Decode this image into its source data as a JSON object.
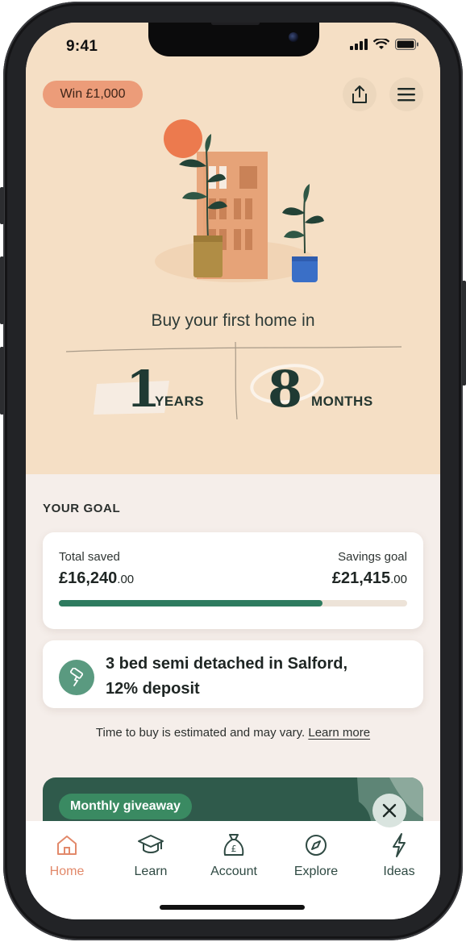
{
  "status": {
    "time": "9:41"
  },
  "header": {
    "promo_label": "Win £1,000",
    "share_icon": "share-icon",
    "menu_icon": "menu-icon"
  },
  "hero": {
    "headline": "Buy your first home in",
    "years_value": "1",
    "years_unit": "YEARS",
    "months_value": "8",
    "months_unit": "MONTHS"
  },
  "goal": {
    "section_label": "YOUR GOAL",
    "total_saved_label": "Total saved",
    "total_saved_main": "£16,240",
    "total_saved_pence": ".00",
    "savings_goal_label": "Savings goal",
    "savings_goal_main": "£21,415",
    "savings_goal_pence": ".00",
    "progress_fraction": 0.758
  },
  "property": {
    "icon": "paint-roller-icon",
    "line1": "3 bed semi detached in Salford,",
    "line2": "12% deposit"
  },
  "disclaimer": {
    "text": "Time to buy is estimated and may vary.",
    "link": "Learn more"
  },
  "giveaway": {
    "label": "Monthly giveaway",
    "close_icon": "close-icon"
  },
  "tabs": [
    {
      "label": "Home",
      "icon": "home-icon",
      "active": true
    },
    {
      "label": "Learn",
      "icon": "graduation-cap-icon",
      "active": false
    },
    {
      "label": "Account",
      "icon": "money-bag-icon",
      "active": false
    },
    {
      "label": "Explore",
      "icon": "compass-icon",
      "active": false
    },
    {
      "label": "Ideas",
      "icon": "lightning-icon",
      "active": false
    }
  ],
  "colors": {
    "hero_bg": "#f5dfc5",
    "accent_orange": "#ec9c79",
    "progress_green": "#2e7b5f",
    "dark_green": "#2f5a4b"
  }
}
